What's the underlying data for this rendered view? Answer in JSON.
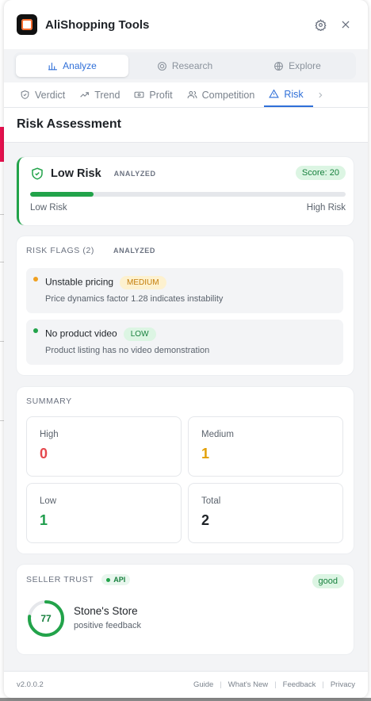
{
  "app": {
    "title": "AliShopping Tools"
  },
  "main_tabs": [
    {
      "label": "Analyze",
      "active": true
    },
    {
      "label": "Research",
      "active": false
    },
    {
      "label": "Explore",
      "active": false
    }
  ],
  "sub_tabs": [
    {
      "label": "Verdict",
      "icon": "shield-check-icon"
    },
    {
      "label": "Trend",
      "icon": "trend-icon"
    },
    {
      "label": "Profit",
      "icon": "banknote-icon"
    },
    {
      "label": "Competition",
      "icon": "users-icon"
    },
    {
      "label": "Risk",
      "icon": "warning-triangle-icon",
      "active": true
    }
  ],
  "section": {
    "title": "Risk Assessment"
  },
  "risk": {
    "level": "Low Risk",
    "status": "ANALYZED",
    "score": "Score: 20",
    "score_value": 20,
    "score_max": 100,
    "low_label": "Low Risk",
    "high_label": "High Risk",
    "accent": "#22a34a"
  },
  "flags": {
    "title": "RISK FLAGS (2)",
    "status": "ANALYZED",
    "items": [
      {
        "title": "Unstable pricing",
        "severity": "MEDIUM",
        "desc": "Price dynamics factor 1.28 indicates instability",
        "dot": "#f0a020",
        "sev_bg": "#fdf1cf",
        "sev_fg": "#c47d0a"
      },
      {
        "title": "No product video",
        "severity": "LOW",
        "desc": "Product listing has no video demonstration",
        "dot": "#22a34a",
        "sev_bg": "#dcf5e3",
        "sev_fg": "#17803d"
      }
    ]
  },
  "summary": {
    "title": "SUMMARY",
    "items": [
      {
        "label": "High",
        "value": "0",
        "color": "#e5484d"
      },
      {
        "label": "Medium",
        "value": "1",
        "color": "#e3a008"
      },
      {
        "label": "Low",
        "value": "1",
        "color": "#1f9d4c"
      },
      {
        "label": "Total",
        "value": "2",
        "color": "#1f2328"
      }
    ]
  },
  "seller": {
    "title": "SELLER TRUST",
    "source": "API",
    "rating": "good",
    "score": "77",
    "score_value": 77,
    "name": "Stone's Store",
    "sub": "positive feedback"
  },
  "footer": {
    "version": "v2.0.0.2",
    "links": [
      "Guide",
      "What's New",
      "Feedback",
      "Privacy"
    ]
  }
}
